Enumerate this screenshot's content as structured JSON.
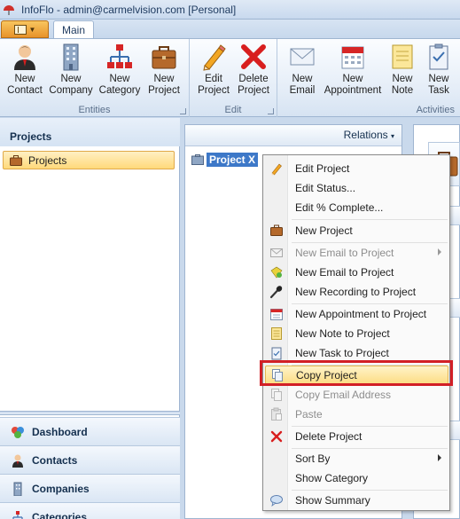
{
  "window": {
    "title": "InfoFlo - admin@carmelvision.com [Personal]"
  },
  "ribbon": {
    "tab_main": "Main",
    "groups": {
      "entities": "Entities",
      "edit": "Edit",
      "activities": "Activities"
    },
    "buttons": {
      "new_contact": [
        "New",
        "Contact"
      ],
      "new_company": [
        "New",
        "Company"
      ],
      "new_category": [
        "New",
        "Category"
      ],
      "new_project": [
        "New",
        "Project"
      ],
      "edit_project": [
        "Edit",
        "Project"
      ],
      "delete_project": [
        "Delete",
        "Project"
      ],
      "new_email": [
        "New",
        "Email"
      ],
      "new_appointment": [
        "New",
        "Appointment"
      ],
      "new_note": [
        "New",
        "Note"
      ],
      "new_task": [
        "New",
        "Task"
      ]
    }
  },
  "leftnav": {
    "header": "Projects",
    "selected_item": "Projects",
    "buttons": {
      "dashboard": "Dashboard",
      "contacts": "Contacts",
      "companies": "Companies",
      "categories": "Categories"
    }
  },
  "center": {
    "relations_label": "Relations",
    "tree_node": "Project X"
  },
  "context_menu": {
    "items": {
      "edit_project": "Edit Project",
      "edit_status": "Edit Status...",
      "edit_complete": "Edit % Complete...",
      "new_project": "New Project",
      "new_email_to_project_1": "New Email to Project",
      "new_email_to_project_2": "New Email to Project",
      "new_recording": "New Recording to Project",
      "new_appointment": "New Appointment to Project",
      "new_note": "New Note to Project",
      "new_task": "New Task to Project",
      "copy_project": "Copy Project",
      "copy_email_address": "Copy Email Address",
      "paste": "Paste",
      "delete_project": "Delete Project",
      "sort_by": "Sort By",
      "show_category": "Show Category",
      "show_summary": "Show Summary"
    },
    "disabled": [
      "new_email_to_project_1",
      "copy_email_address",
      "paste"
    ]
  },
  "colors": {
    "selection_blue": "#3d78c8",
    "hover_gold": "#fcdc82",
    "highlight_red": "#d21f26"
  }
}
